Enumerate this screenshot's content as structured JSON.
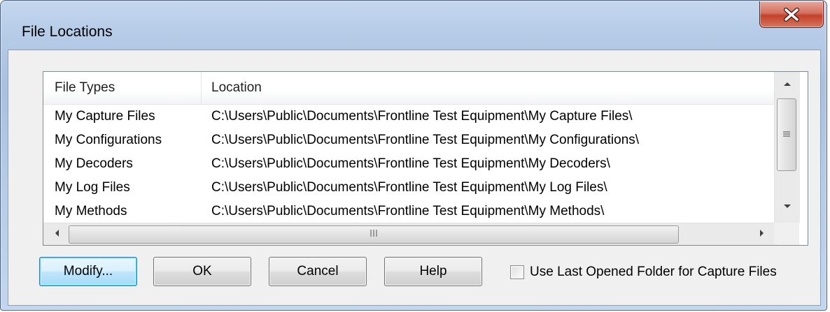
{
  "window": {
    "title": "File Locations"
  },
  "list": {
    "columns": [
      "File Types",
      "Location"
    ],
    "rows": [
      {
        "type": "My Capture Files",
        "location": "C:\\Users\\Public\\Documents\\Frontline Test Equipment\\My Capture Files\\"
      },
      {
        "type": "My Configurations",
        "location": "C:\\Users\\Public\\Documents\\Frontline Test Equipment\\My Configurations\\"
      },
      {
        "type": "My Decoders",
        "location": "C:\\Users\\Public\\Documents\\Frontline Test Equipment\\My Decoders\\"
      },
      {
        "type": "My Log Files",
        "location": "C:\\Users\\Public\\Documents\\Frontline Test Equipment\\My Log Files\\"
      },
      {
        "type": "My Methods",
        "location": "C:\\Users\\Public\\Documents\\Frontline Test Equipment\\My Methods\\"
      }
    ]
  },
  "buttons": {
    "modify": "Modify...",
    "ok": "OK",
    "cancel": "Cancel",
    "help": "Help"
  },
  "checkbox": {
    "label": "Use Last Opened Folder for Capture Files",
    "checked": false
  },
  "icons": {
    "close": "close-icon",
    "scroll_up": "scroll-up-arrow-icon",
    "scroll_down": "scroll-down-arrow-icon",
    "scroll_left": "scroll-left-arrow-icon",
    "scroll_right": "scroll-right-arrow-icon"
  },
  "colors": {
    "title_bar": "#b8cde8",
    "close_button": "#c3412c",
    "default_button_border": "#3c7fb1"
  }
}
